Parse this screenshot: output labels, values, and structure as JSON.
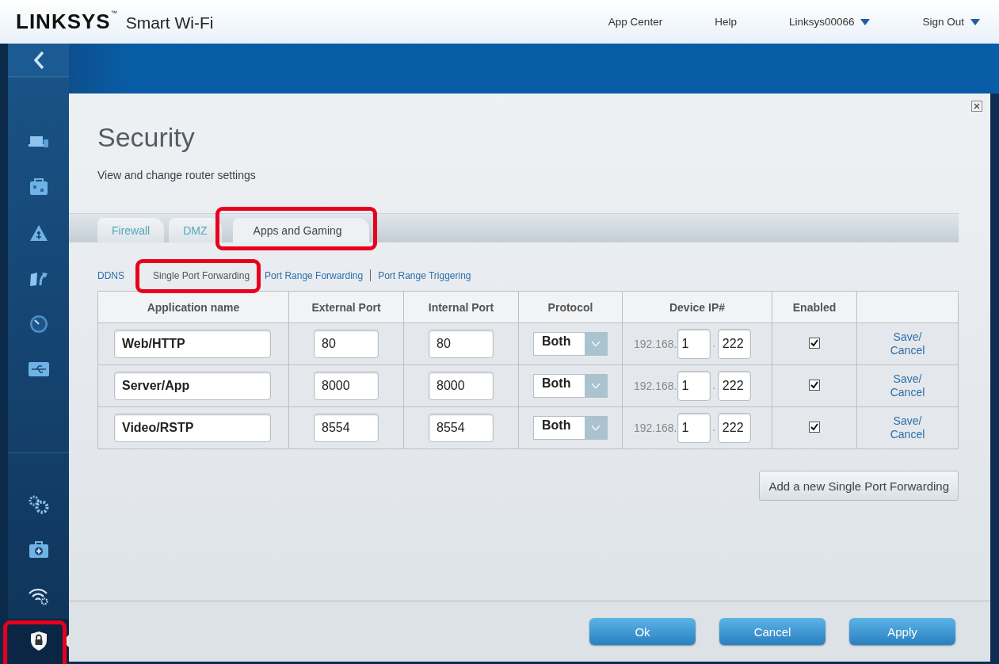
{
  "header": {
    "logo": "LINKSYS",
    "logo_mark": "™",
    "product": "Smart Wi-Fi",
    "links": [
      {
        "label": "App Center",
        "dropdown": false
      },
      {
        "label": "Help",
        "dropdown": false
      },
      {
        "label": "Linksys00066",
        "dropdown": true
      },
      {
        "label": "Sign Out",
        "dropdown": true
      }
    ]
  },
  "sidebar": {
    "groups": [
      {
        "items": [
          {
            "kind": "devices",
            "selected": false,
            "highlighted": false
          },
          {
            "kind": "toolbox",
            "selected": false,
            "highlighted": false
          },
          {
            "kind": "parental",
            "selected": false,
            "highlighted": false
          },
          {
            "kind": "update",
            "selected": false,
            "highlighted": false
          },
          {
            "kind": "speed",
            "selected": false,
            "highlighted": false
          },
          {
            "kind": "usb",
            "selected": false,
            "highlighted": false
          }
        ]
      },
      {
        "items": [
          {
            "kind": "gears",
            "selected": false,
            "highlighted": false
          },
          {
            "kind": "medkit",
            "selected": false,
            "highlighted": false
          },
          {
            "kind": "wireless",
            "selected": false,
            "highlighted": false
          },
          {
            "kind": "security",
            "selected": true,
            "highlighted": true
          }
        ]
      }
    ]
  },
  "page": {
    "title": "Security",
    "subtitle": "View and change router settings",
    "tabs": [
      {
        "label": "Firewall",
        "selected": false,
        "highlighted": false
      },
      {
        "label": "DMZ",
        "selected": false,
        "highlighted": false
      },
      {
        "label": "Apps and Gaming",
        "selected": true,
        "highlighted": true
      }
    ],
    "subnav": [
      {
        "label": "DDNS",
        "selected": false,
        "highlighted": false
      },
      {
        "label": "Single Port Forwarding",
        "selected": true,
        "highlighted": true
      },
      {
        "label": "Port Range Forwarding",
        "selected": false,
        "highlighted": false
      },
      {
        "label": "Port Range Triggering",
        "selected": false,
        "highlighted": false
      }
    ],
    "table": {
      "columns": [
        "Application name",
        "External Port",
        "Internal Port",
        "Protocol",
        "Device IP#",
        "Enabled"
      ],
      "rows": [
        {
          "name": "Web/HTTP",
          "external_port": "80",
          "internal_port": "80",
          "protocol": "Both",
          "ip_prefix": "192.168.",
          "ip_3": "1",
          "ip_sep": ".",
          "ip_4": "222",
          "enabled": true,
          "action": "Save/ Cancel"
        },
        {
          "name": "Server/App",
          "external_port": "8000",
          "internal_port": "8000",
          "protocol": "Both",
          "ip_prefix": "192.168.",
          "ip_3": "1",
          "ip_sep": ".",
          "ip_4": "222",
          "enabled": true,
          "action": "Save/ Cancel"
        },
        {
          "name": "Video/RSTP",
          "external_port": "8554",
          "internal_port": "8554",
          "protocol": "Both",
          "ip_prefix": "192.168.",
          "ip_3": "1",
          "ip_sep": ".",
          "ip_4": "222",
          "enabled": true,
          "action": "Save/ Cancel"
        }
      ]
    },
    "add_button": "Add a new Single Port Forwarding",
    "footer_buttons": [
      "Ok",
      "Cancel",
      "Apply"
    ]
  }
}
